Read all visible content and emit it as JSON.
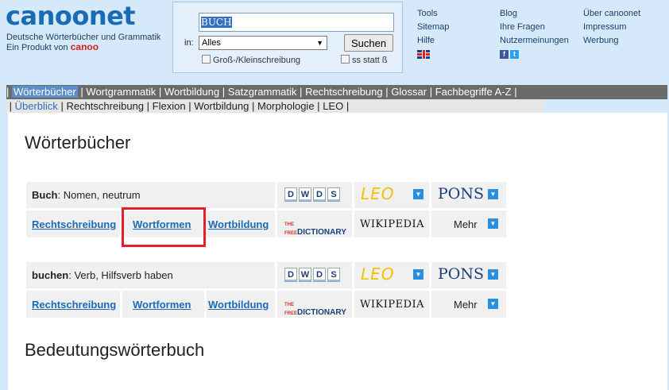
{
  "header": {
    "logo_text": "canoonet",
    "tagline_line1": "Deutsche Wörterbücher und Grammatik",
    "tagline_line2_prefix": "Ein Produkt von ",
    "tagline_brand": "canoo"
  },
  "search": {
    "query": "BUCH",
    "in_label": "in:",
    "scope_selected": "Alles",
    "submit_label": "Suchen",
    "option_case": "Groß-/Kleinschreibung",
    "option_ss": "ss statt ß"
  },
  "toplinks": {
    "col1": [
      "Tools",
      "Sitemap",
      "Hilfe"
    ],
    "col2": [
      "Blog",
      "Ihre Fragen",
      "Nutzermeinungen"
    ],
    "col3": [
      "Über canoonet",
      "Impressum",
      "Werbung"
    ]
  },
  "nav_primary": {
    "items": [
      "Wörterbücher",
      "Wortgrammatik",
      "Wortbildung",
      "Satzgrammatik",
      "Rechtschreibung",
      "Glossar",
      "Fachbegriffe A-Z"
    ],
    "active": "Wörterbücher"
  },
  "nav_secondary": {
    "items": [
      "Überblick",
      "Rechtschreibung",
      "Flexion",
      "Wortbildung",
      "Morphologie",
      "LEO"
    ],
    "active": "Überblick"
  },
  "main": {
    "heading": "Wörterbücher",
    "section2_heading": "Bedeutungswörterbuch",
    "entries": [
      {
        "word": "Buch",
        "description": ": Nomen, neutrum",
        "links": [
          "Rechtschreibung",
          "Wortformen",
          "Wortbildung"
        ]
      },
      {
        "word": "buchen",
        "description": ": Verb, Hilfsverb haben",
        "links": [
          "Rechtschreibung",
          "Wortformen",
          "Wortbildung"
        ]
      }
    ],
    "partners": {
      "dwds_letters": [
        "D",
        "W",
        "D",
        "S"
      ],
      "leo": "LEO",
      "pons": "PONS",
      "tfd_prefix": "THE FREE",
      "tfd_main": "DICTIONARY",
      "wikipedia": "WIKIPEDIA",
      "more": "Mehr"
    }
  },
  "colors": {
    "page_bg": "#d6e9fa",
    "logo": "#1a6bb5",
    "nav_bg": "#6a6a6a",
    "nav_active": "#5b8fc7",
    "link": "#1a6bb5",
    "highlight_box": "#e0202a"
  }
}
